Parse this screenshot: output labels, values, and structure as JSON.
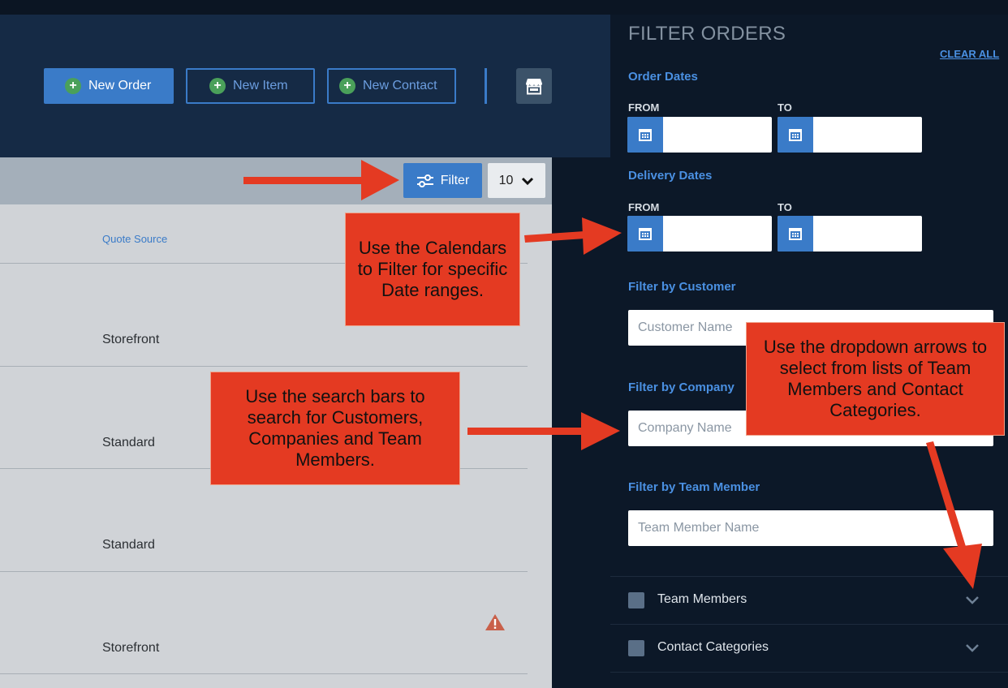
{
  "header": {
    "new_order_label": "New Order",
    "new_item_label": "New Item",
    "new_contact_label": "New Contact",
    "plus_symbol": "+",
    "store_icon": "storefront-icon"
  },
  "toolbar": {
    "filter_label": "Filter",
    "filter_icon": "sliders-icon",
    "per_page_value": "10"
  },
  "table": {
    "column_header": "Quote Source",
    "rows": [
      "Storefront",
      "Standard",
      "Standard",
      "Storefront"
    ],
    "warning_icon": "warning-triangle-icon"
  },
  "filter_panel": {
    "title": "FILTER ORDERS",
    "clear_all": "CLEAR ALL",
    "order_dates": {
      "label": "Order Dates",
      "from": "FROM",
      "to": "TO"
    },
    "delivery_dates": {
      "label": "Delivery Dates",
      "from": "FROM",
      "to": "TO"
    },
    "customer": {
      "label": "Filter by Customer",
      "placeholder": "Customer Name"
    },
    "company": {
      "label": "Filter by Company",
      "placeholder": "Company Name"
    },
    "team_member": {
      "label": "Filter by Team Member",
      "placeholder": "Team Member Name"
    },
    "accordions": [
      {
        "label": "Team Members"
      },
      {
        "label": "Contact Categories"
      }
    ]
  },
  "callouts": {
    "calendars": "Use the Calendars to Filter for specific Date ranges.",
    "search": "Use the search bars to search for Customers, Companies and Team Members.",
    "dropdown": "Use the dropdown arrows to select from lists of Team Members and Contact Categories."
  },
  "colors": {
    "panel_bg": "#0c1828",
    "header_bg": "#152a45",
    "accent": "#3a7bc8",
    "callout": "#e43a22",
    "arrow": "#e43a22"
  }
}
